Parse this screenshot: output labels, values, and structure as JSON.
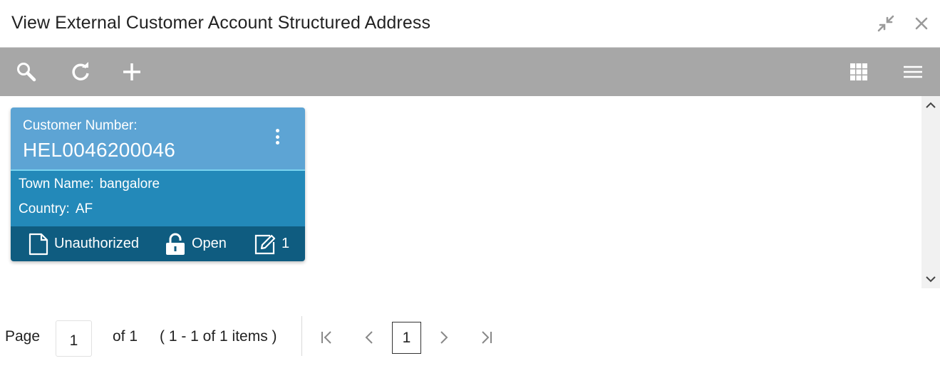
{
  "window": {
    "title": "View External Customer Account Structured Address"
  },
  "toolbar": {
    "icons": [
      "search-icon",
      "refresh-icon",
      "add-icon",
      "grid-view-icon",
      "list-view-icon"
    ],
    "background": "#a7a7a7"
  },
  "card": {
    "header_label": "Customer Number:",
    "header_value": "HEL0046200046",
    "fields": [
      {
        "label": "Town Name:",
        "value": "bangalore"
      },
      {
        "label": "Country:",
        "value": "AF"
      }
    ],
    "footer": {
      "status": "Unauthorized",
      "lock_status": "Open",
      "modification_number": "1"
    },
    "colors": {
      "header": "#5da4d4",
      "body": "#2389b9",
      "footer": "#0f5c80"
    }
  },
  "pagination": {
    "page_label": "Page",
    "page_value": "1",
    "of_text": "of 1",
    "items_text": "( 1 - 1 of 1 items )",
    "current_page": "1"
  }
}
